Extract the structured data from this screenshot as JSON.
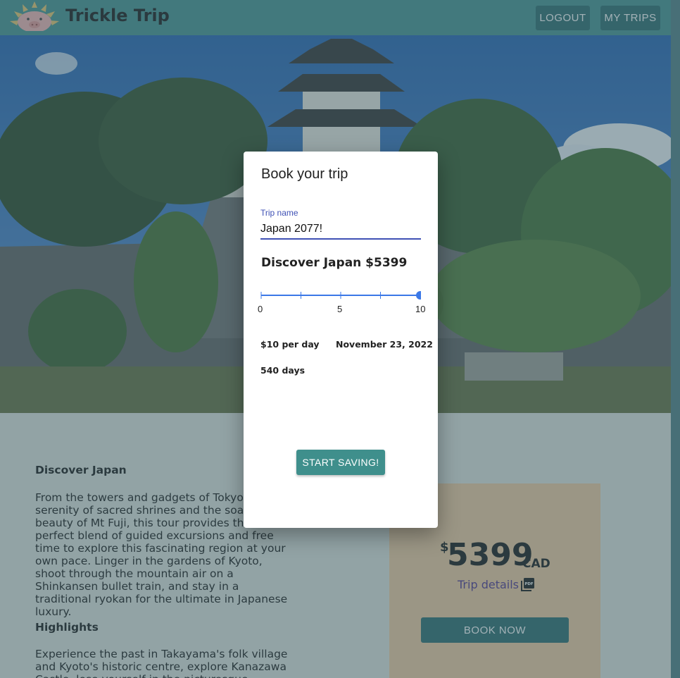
{
  "app": {
    "brand": "Trickle Trip"
  },
  "nav": {
    "logout_label": "LOGOUT",
    "my_trips_label": "MY TRIPS"
  },
  "trip": {
    "title": "Discover Japan",
    "description": "From the towers and gadgets of Tokyo to the serenity of sacred shrines and the soaring beauty of Mt Fuji, this tour provides the perfect blend of guided excursions and free time to explore this fascinating region at your own pace. Linger in the gardens of Kyoto, shoot through the mountain air on a Shinkansen bullet train, and stay in a traditional ryokan for the ultimate in Japanese luxury.",
    "highlights_title": "Highlights",
    "highlights_text": "Experience the past in Takayama's folk village and Kyoto's historic centre, explore Kanazawa Castle, lose yourself in the picturesque Kenroku"
  },
  "price_card": {
    "currency_symbol": "$",
    "amount": "5399",
    "currency": "CAD",
    "trip_details_label": "Trip details",
    "pdf_icon": "pdf-icon",
    "book_now_label": "BOOK NOW"
  },
  "dialog": {
    "title": "Book your trip",
    "trip_name_label": "Trip name",
    "trip_name_value": "Japan 2077!",
    "trip_heading": "Discover Japan $5399",
    "slider": {
      "min": 0,
      "max": 10,
      "value": 10,
      "tick_labels": [
        "0",
        "5",
        "10"
      ]
    },
    "per_day": "$10 per day",
    "date": "November 23, 2022",
    "duration": "540 days",
    "start_button_label": "START SAVING!"
  },
  "colors": {
    "navbar": "#3f8f8c",
    "button_dark": "#256669",
    "button_primary": "#3f8f8c",
    "input_accent": "#3f51b5",
    "slider": "#3b78e7",
    "price_card": "#f1c99d"
  }
}
